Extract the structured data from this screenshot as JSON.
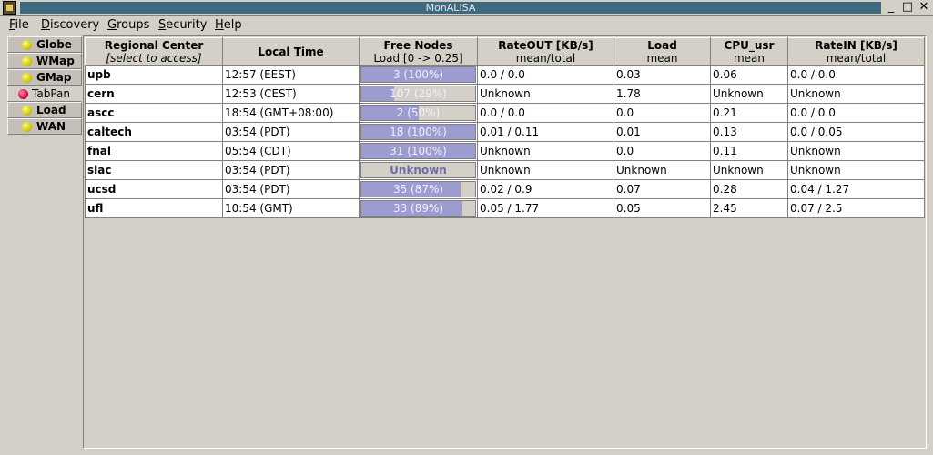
{
  "window": {
    "title": "MonALISA",
    "minimize": "_",
    "maximize": "□",
    "close": "✕"
  },
  "menu": [
    {
      "label": "File",
      "mnemonic": "F",
      "rest": "ile"
    },
    {
      "label": "Discovery",
      "mnemonic": "D",
      "rest": "iscovery"
    },
    {
      "label": "Groups",
      "mnemonic": "G",
      "rest": "roups"
    },
    {
      "label": "Security",
      "mnemonic": "S",
      "rest": "ecurity"
    },
    {
      "label": "Help",
      "mnemonic": "H",
      "rest": "elp"
    }
  ],
  "tabs": [
    {
      "label": "Globe",
      "icon": "yellow-dot-icon",
      "active": false
    },
    {
      "label": "WMap",
      "icon": "yellow-dot-icon",
      "active": false
    },
    {
      "label": "GMap",
      "icon": "yellow-dot-icon",
      "active": false
    },
    {
      "label": "TabPan",
      "icon": "red-dot-icon",
      "active": true
    },
    {
      "label": "Load",
      "icon": "yellow-dot-icon",
      "active": false
    },
    {
      "label": "WAN",
      "icon": "yellow-dot-icon",
      "active": false
    }
  ],
  "table": {
    "columns": [
      {
        "title": "Regional Center",
        "sub": "[select to access]",
        "italic": true
      },
      {
        "title": "Local Time",
        "sub": ""
      },
      {
        "title": "Free Nodes",
        "sub": "Load [0 -> 0.25]"
      },
      {
        "title": "RateOUT [KB/s]",
        "sub": "mean/total"
      },
      {
        "title": "Load",
        "sub": "mean"
      },
      {
        "title": "CPU_usr",
        "sub": "mean"
      },
      {
        "title": "RateIN [KB/s]",
        "sub": "mean/total"
      }
    ],
    "rows": [
      {
        "center": "upb",
        "time": "12:57 (EEST)",
        "free_nodes": "3 (100%)",
        "fill": 1.0,
        "rate_out": "0.0 / 0.0",
        "load": "0.03",
        "cpu_usr": "0.06",
        "rate_in": "0.0 / 0.0"
      },
      {
        "center": "cern",
        "time": "12:53 (CEST)",
        "free_nodes": "107 (29%)",
        "fill": 0.29,
        "rate_out": "Unknown",
        "load": "1.78",
        "cpu_usr": "Unknown",
        "rate_in": "Unknown"
      },
      {
        "center": "ascc",
        "time": "18:54 (GMT+08:00)",
        "free_nodes": "2 (50%)",
        "fill": 0.5,
        "rate_out": "0.0 / 0.0",
        "load": "0.0",
        "cpu_usr": "0.21",
        "rate_in": "0.0 / 0.0"
      },
      {
        "center": "caltech",
        "time": "03:54 (PDT)",
        "free_nodes": "18 (100%)",
        "fill": 1.0,
        "rate_out": "0.01 / 0.11",
        "load": "0.01",
        "cpu_usr": "0.13",
        "rate_in": "0.0 / 0.05"
      },
      {
        "center": "fnal",
        "time": "05:54 (CDT)",
        "free_nodes": "31 (100%)",
        "fill": 1.0,
        "rate_out": "Unknown",
        "load": "0.0",
        "cpu_usr": "0.11",
        "rate_in": "Unknown"
      },
      {
        "center": "slac",
        "time": "03:54 (PDT)",
        "free_nodes": "Unknown",
        "fill": 0,
        "rate_out": "Unknown",
        "load": "Unknown",
        "cpu_usr": "Unknown",
        "rate_in": "Unknown"
      },
      {
        "center": "ucsd",
        "time": "03:54 (PDT)",
        "free_nodes": "35 (87%)",
        "fill": 0.87,
        "rate_out": "0.02 / 0.9",
        "load": "0.07",
        "cpu_usr": "0.28",
        "rate_in": "0.04 / 1.27"
      },
      {
        "center": "ufl",
        "time": "10:54 (GMT)",
        "free_nodes": "33 (89%)",
        "fill": 0.89,
        "rate_out": "0.05 / 1.77",
        "load": "0.05",
        "cpu_usr": "2.45",
        "rate_in": "0.07 / 2.5"
      }
    ]
  }
}
